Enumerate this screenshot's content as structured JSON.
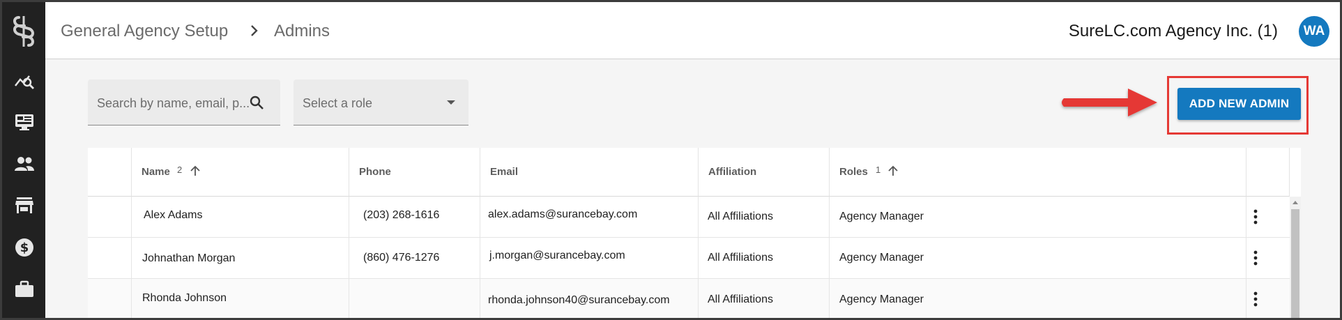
{
  "header": {
    "breadcrumb": [
      "General Agency Setup",
      "Admins"
    ],
    "agency_name": "SureLC.com Agency Inc. (1)",
    "avatar_initials": "WA"
  },
  "sidebar": {
    "icons": [
      "surelc-logo-icon",
      "analytics-search-icon",
      "desktop-dashboard-icon",
      "people-icon",
      "storefront-icon",
      "dollar-icon",
      "briefcase-icon"
    ]
  },
  "filters": {
    "search_placeholder": "Search by name, email, p...",
    "role_placeholder": "Select a role"
  },
  "actions": {
    "add_label": "ADD NEW ADMIN"
  },
  "table": {
    "columns": [
      {
        "label": "Name",
        "sort_order": "2"
      },
      {
        "label": "Phone",
        "sort_order": ""
      },
      {
        "label": "Email",
        "sort_order": ""
      },
      {
        "label": "Affiliation",
        "sort_order": ""
      },
      {
        "label": "Roles",
        "sort_order": "1"
      }
    ],
    "rows": [
      {
        "name": "Alex Adams",
        "phone": "(203) 268-1616",
        "email": "alex.adams@surancebay.com",
        "affiliation": "All Affiliations",
        "role": "Agency Manager"
      },
      {
        "name": "Johnathan Morgan",
        "phone": "(860) 476-1276",
        "email": "j.morgan@surancebay.com",
        "affiliation": "All Affiliations",
        "role": "Agency Manager"
      },
      {
        "name": "Rhonda Johnson",
        "phone": "",
        "email": "rhonda.johnson40@surancebay.com",
        "affiliation": "All Affiliations",
        "role": "Agency Manager"
      }
    ]
  },
  "colors": {
    "sidebar": "#212121",
    "accent": "#1479bf",
    "highlight": "#e53935"
  }
}
